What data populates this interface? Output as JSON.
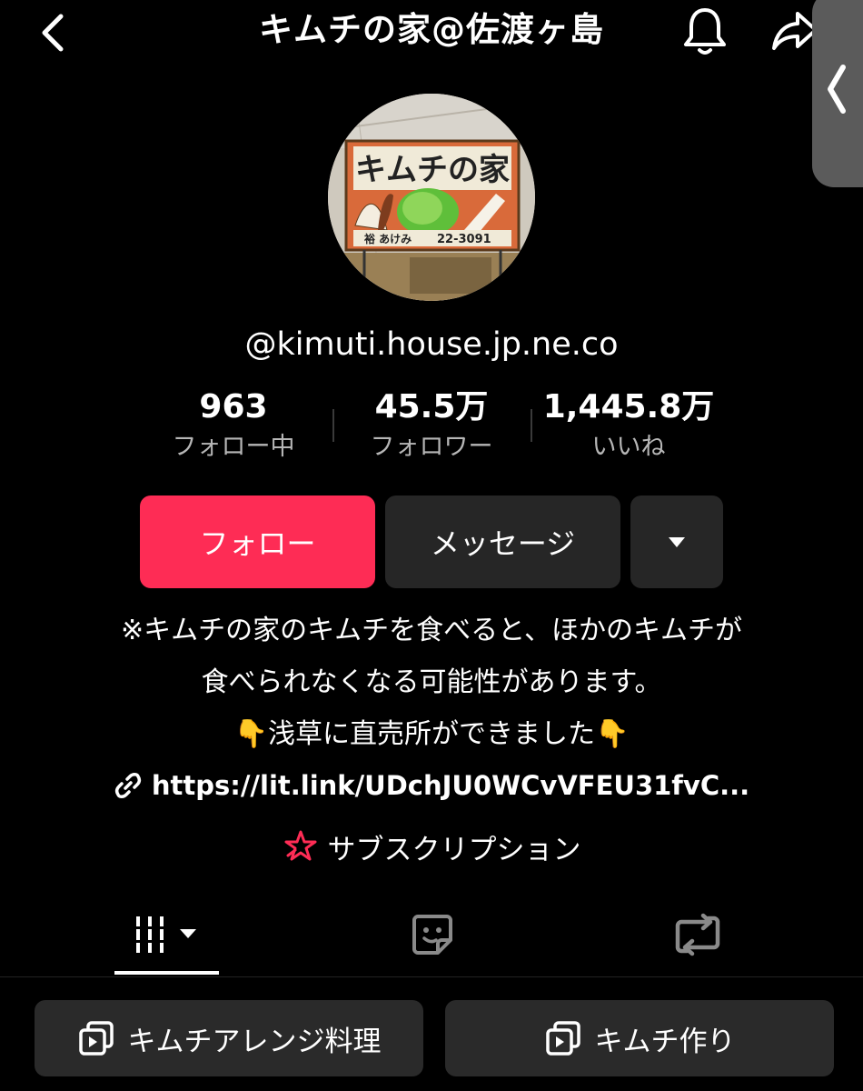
{
  "header": {
    "title": "キムチの家@佐渡ヶ島",
    "icons": {
      "back": "chevron-left-icon",
      "notify": "bell-icon",
      "share": "share-arrow-icon",
      "side": "chevron-left-icon"
    }
  },
  "profile": {
    "avatar_sign": {
      "title": "キムチの家",
      "footer_left": "裕 あけみ",
      "footer_right": "22-3091"
    },
    "handle": "@kimuti.house.jp.ne.co"
  },
  "stats": [
    {
      "value": "963",
      "label": "フォロー中"
    },
    {
      "value": "45.5万",
      "label": "フォロワー"
    },
    {
      "value": "1,445.8万",
      "label": "いいね"
    }
  ],
  "actions": {
    "follow": "フォロー",
    "message": "メッセージ",
    "more_icon": "caret-down-icon"
  },
  "bio": {
    "line1": "※キムチの家のキムチを食べると、ほかのキムチが",
    "line2": "食べられなくなる可能性があります。",
    "line3": "浅草に直売所ができました",
    "line3_emoji": "👇",
    "link": "https://lit.link/UDchJU0WCvVFEU31fvC...",
    "subscription": "サブスクリプション"
  },
  "tabs": {
    "items": [
      "videos-grid-icon",
      "favorites-sticker-icon",
      "repost-icon"
    ],
    "active": 0
  },
  "playlists": [
    {
      "label": "キムチアレンジ料理"
    },
    {
      "label": "キムチ作り"
    }
  ],
  "colors": {
    "background": "#000000",
    "follow_button": "#fe2c55",
    "secondary_button": "#262626",
    "muted_text": "#b6b6b6",
    "subscription_icon": "#fe2c55"
  }
}
